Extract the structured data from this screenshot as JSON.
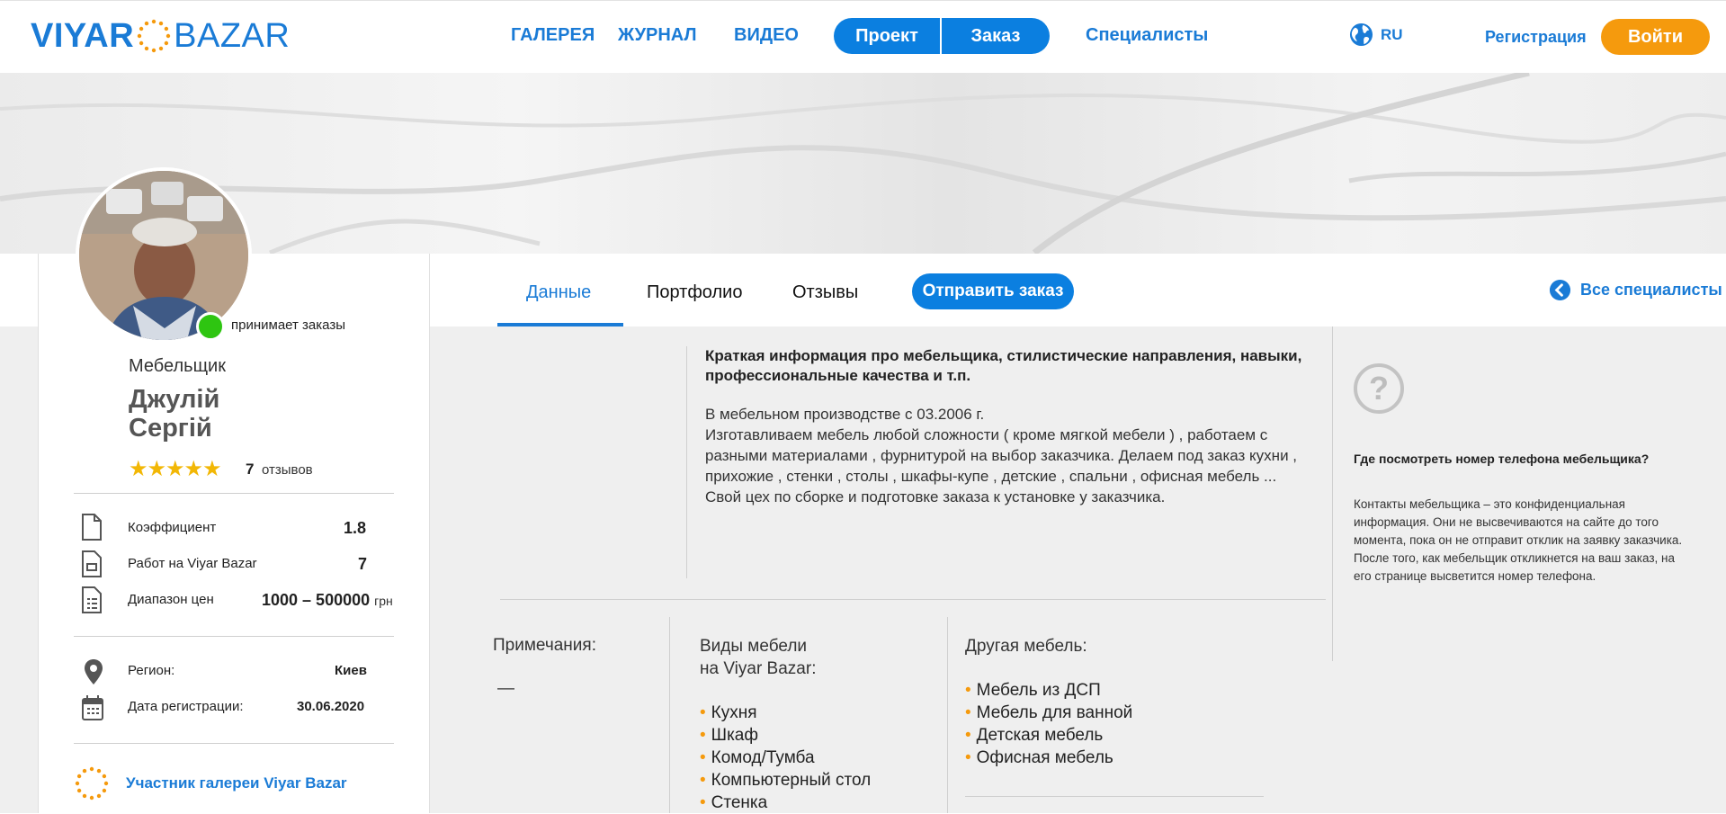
{
  "header": {
    "logo_part1": "VIYAR",
    "logo_part2": "BAZAR",
    "nav": [
      "ГАЛЕРЕЯ",
      "ЖУРНАЛ",
      "ВИДЕО"
    ],
    "project_btn": "Проект",
    "order_btn": "Заказ",
    "specialists": "Специалисты",
    "lang": "RU",
    "register": "Регистрация",
    "login": "Войти"
  },
  "profile": {
    "status": "принимает заказы",
    "profession": "Мебельщик",
    "first_name": "Джулій",
    "last_name": "Сергій",
    "rating_stars": 5,
    "stars_text": "★★★★★",
    "reviews_count": "7",
    "reviews_label": "отзывов",
    "stats": [
      {
        "label": "Коэффициент",
        "value": "1.8",
        "icon": "file-icon"
      },
      {
        "label": "Работ на Viyar Bazar",
        "value": "7",
        "icon": "works-icon"
      },
      {
        "label": "Диапазон цен",
        "value": "1000 – 500000",
        "unit": "грн",
        "icon": "price-list-icon"
      }
    ],
    "region_label": "Регион:",
    "region_value": "Киев",
    "reg_date_label": "Дата регистрации:",
    "reg_date_value": "30.06.2020",
    "gallery_member": "Участник галереи Viyar Bazar"
  },
  "tabs": {
    "data": "Данные",
    "portfolio": "Портфолио",
    "reviews": "Отзывы",
    "send_order": "Отправить заказ",
    "all_specialists": "Все специалисты"
  },
  "about": {
    "title": "Краткая информация про мебельщика, стилистические направления, навыки, профессиональные качества и т.п.",
    "text": "В мебельном производстве с 03.2006 г.\nИзготавливаем мебель любой сложности ( кроме мягкой мебели ) , работаем с разными материалами , фурнитурой на выбор заказчика. Делаем под заказ кухни , прихожие , стенки , столы , шкафы-купе , детские , спальни , офисная мебель ...\nСвой цех по сборке и подготовке заказа к установке у заказчика."
  },
  "sidebar": {
    "question": "Где посмотреть номер телефона мебельщика?",
    "answer": "Контакты мебельщика – это конфиденциальная информация. Они не высвечиваются на сайте до того момента, пока он не отправит отклик на заявку заказчика. После того, как мебельщик откликнется на ваш заказ, на его странице высветится номер телефона."
  },
  "details": {
    "notes_label": "Примечания:",
    "notes_value": "—",
    "types_title_1": "Виды мебели",
    "types_title_2": "на Viyar Bazar:",
    "types": [
      "Кухня",
      "Шкаф",
      "Комод/Тумба",
      "Компьютерный стол",
      "Стенка"
    ],
    "other_title": "Другая мебель:",
    "other": [
      "Мебель из ДСП",
      "Мебель для ванной",
      "Детская мебель",
      "Офисная мебель"
    ]
  },
  "colors": {
    "brand_blue": "#1a7bd6",
    "accent_orange": "#f59a0d",
    "online_green": "#2ec511"
  }
}
